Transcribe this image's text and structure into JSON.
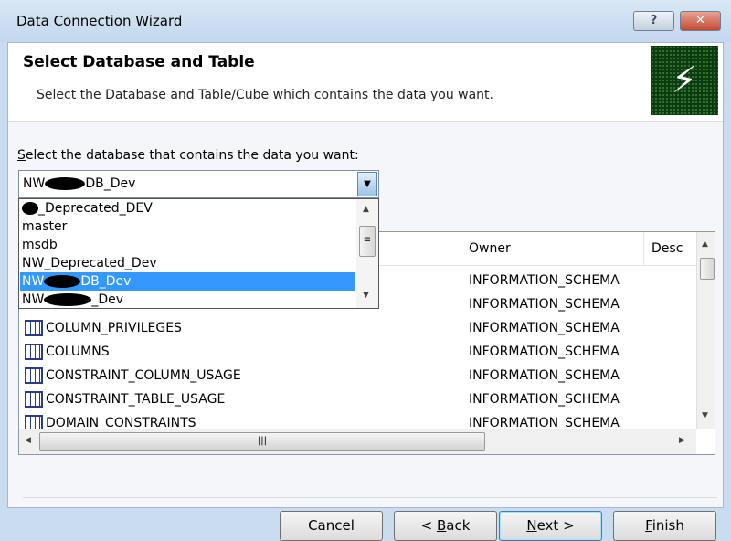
{
  "window": {
    "title": "Data Connection Wizard",
    "help_label": "?",
    "close_label": "✕"
  },
  "header": {
    "title": "Select Database and Table",
    "subtitle": "Select the Database and Table/Cube which contains the data you want.",
    "logo_icon": "data-connection-plug-icon"
  },
  "database": {
    "label_accesskey": "S",
    "label_rest": "elect the database that contains the data you want:",
    "selected_prefix": "NW",
    "selected_suffix": "DB_Dev",
    "options": [
      {
        "prefix": "",
        "suffix": "_Deprecated_DEV",
        "redacted": true
      },
      {
        "prefix": "master",
        "suffix": "",
        "redacted": false
      },
      {
        "prefix": "msdb",
        "suffix": "",
        "redacted": false
      },
      {
        "prefix": "NW_Deprecated_Dev",
        "suffix": "",
        "redacted": false
      },
      {
        "prefix": "NW",
        "suffix": "DB_Dev",
        "redacted": true,
        "selected": true
      },
      {
        "prefix": "NW",
        "suffix": "_Dev",
        "redacted": true
      }
    ]
  },
  "grid": {
    "columns": [
      "Owner",
      "Desc"
    ],
    "rows": [
      {
        "name": "COLUMN_PRIVILEGES",
        "owner": "INFORMATION_SCHEMA"
      },
      {
        "name": "COLUMNS",
        "owner": "INFORMATION_SCHEMA"
      },
      {
        "name": "CONSTRAINT_COLUMN_USAGE",
        "owner": "INFORMATION_SCHEMA"
      },
      {
        "name": "CONSTRAINT_TABLE_USAGE",
        "owner": "INFORMATION_SCHEMA"
      },
      {
        "name": "DOMAIN_CONSTRAINTS",
        "owner": "INFORMATION_SCHEMA"
      }
    ],
    "hidden_owners": [
      "INFORMATION_SCHEMA",
      "INFORMATION_SCHEMA"
    ]
  },
  "buttons": {
    "cancel": "Cancel",
    "back_pre": "< ",
    "back_key": "B",
    "back_rest": "ack",
    "next_key": "N",
    "next_rest": "ext >",
    "finish_key": "F",
    "finish_rest": "inish"
  }
}
